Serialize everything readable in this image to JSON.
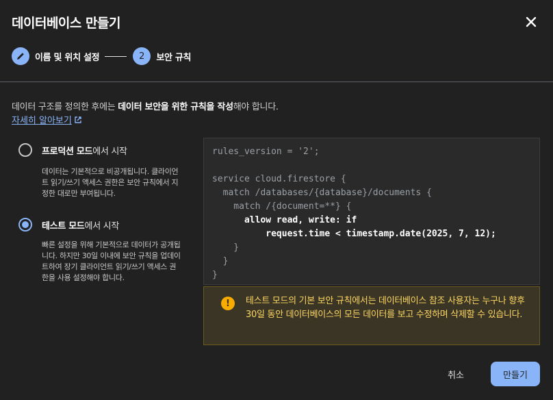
{
  "dialog": {
    "title": "데이터베이스 만들기"
  },
  "stepper": {
    "step1": {
      "label": "이름 및 위치 설정",
      "icon": "pencil-icon"
    },
    "step2": {
      "number": "2",
      "label": "보안 규칙"
    }
  },
  "intro": {
    "prefix": "데이터 구조를 정의한 후에는 ",
    "bold": "데이터 보안을 위한 규칙을 작성",
    "suffix": "해야 합니다.",
    "link_label": "자세히 알아보기"
  },
  "options": {
    "production": {
      "title_bold": "프로덕션 모드",
      "title_rest": "에서 시작",
      "selected": false,
      "desc": "데이터는 기본적으로 비공개됩니다. 클라이언트 읽기/쓰기 액세스 권한은 보안 규칙에서 지정한 대로만 부여됩니다."
    },
    "test": {
      "title_bold": "테스트 모드",
      "title_rest": "에서 시작",
      "selected": true,
      "desc": "빠른 설정을 위해 기본적으로 데이터가 공개됩니다. 하지만 30일 이내에 보안 규칙을 업데이트하여 장기 클라이언트 읽기/쓰기 액세스 권한을 사용 설정해야 합니다."
    }
  },
  "code": {
    "lines": [
      "rules_version = '2';",
      "",
      "service cloud.firestore {",
      "  match /databases/{database}/documents {",
      "    match /{document=**} {",
      "      allow read, write: if",
      "          request.time < timestamp.date(2025, 7, 12);",
      "    }",
      "  }",
      "}"
    ]
  },
  "warning": {
    "icon": "warning-icon",
    "text": "테스트 모드의 기본 보안 규칙에서는 데이터베이스 참조 사용자는 누구나 향후 30일 동안 데이터베이스의 모든 데이터를 보고 수정하며 삭제할 수 있습니다."
  },
  "actions": {
    "cancel_label": "취소",
    "create_label": "만들기"
  },
  "colors": {
    "accent": "#8ab4f8",
    "warning": "#f9ab00",
    "warning_text": "#fdd663",
    "background": "#212121"
  }
}
